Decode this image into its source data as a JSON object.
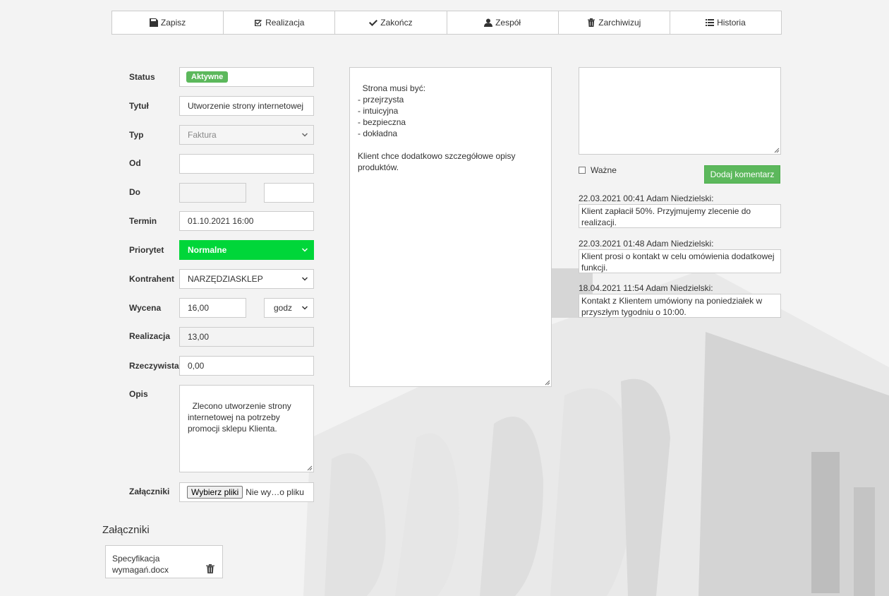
{
  "toolbar": {
    "buttons": [
      {
        "label": "Zapisz",
        "icon": "save-icon"
      },
      {
        "label": "Realizacja",
        "icon": "check-square-icon"
      },
      {
        "label": "Zakończ",
        "icon": "check-icon"
      },
      {
        "label": "Zespół",
        "icon": "user-icon"
      },
      {
        "label": "Zarchiwizuj",
        "icon": "trash-icon"
      },
      {
        "label": "Historia",
        "icon": "list-icon"
      }
    ]
  },
  "form": {
    "status_label": "Status",
    "status_value": "Aktywne",
    "title_label": "Tytuł",
    "title_value": "Utworzenie strony internetowej",
    "type_label": "Typ",
    "type_value": "Faktura",
    "from_label": "Od",
    "from_value": "",
    "to_label": "Do",
    "to_value_1": "",
    "to_value_2": "",
    "deadline_label": "Termin",
    "deadline_value": "01.10.2021 16:00",
    "priority_label": "Priorytet",
    "priority_value": "Normalne",
    "contractor_label": "Kontrahent",
    "contractor_value": "NARZĘDZIASKLEP",
    "estimate_label": "Wycena",
    "estimate_value": "16,00",
    "estimate_unit": "godz",
    "realization_label": "Realizacja",
    "realization_value": "13,00",
    "actual_label": "Rzeczywista",
    "actual_value": "0,00",
    "description_label": "Opis",
    "description_value": "Zlecono utworzenie strony internetowej na potrzeby promocji sklepu Klienta.",
    "attachments_label": "Załączniki",
    "file_button": "Wybierz pliki",
    "file_status": "Nie wy…o pliku"
  },
  "notes": {
    "text": "Strona musi być:\n- przejrzysta\n- intuicyjna\n- bezpieczna\n- dokładna\n\nKlient chce dodatkowo szczegółowe opisy produktów."
  },
  "attachments": {
    "title": "Załączniki",
    "files": [
      {
        "name": "Specyfikacja wymagań.docx"
      }
    ]
  },
  "comments": {
    "input_value": "",
    "important_label": "Ważne",
    "add_button": "Dodaj komentarz",
    "items": [
      {
        "meta": "22.03.2021 00:41 Adam Niedzielski:",
        "text": "Klient zapłacił 50%. Przyjmujemy zlecenie do realizacji."
      },
      {
        "meta": "22.03.2021 01:48 Adam Niedzielski:",
        "text": "Klient prosi o kontakt w celu omówienia dodatkowej funkcji."
      },
      {
        "meta": "18.04.2021 11:54 Adam Niedzielski:",
        "text": "Kontakt z Klientem umówiony na poniedziałek w przyszłym tygodniu o 10:00."
      }
    ]
  },
  "colors": {
    "accent_green": "#5cb85c",
    "priority_green": "#00d639"
  }
}
